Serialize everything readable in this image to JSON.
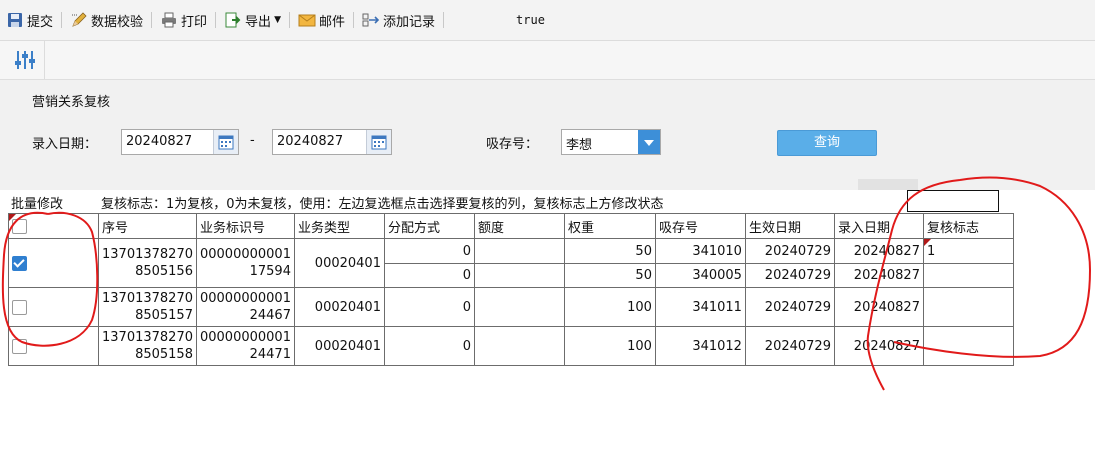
{
  "toolbar": {
    "items": [
      {
        "label": "提交",
        "icon": "save-icon"
      },
      {
        "label": "数据校验",
        "icon": "pencil-icon"
      },
      {
        "label": "打印",
        "icon": "printer-icon"
      },
      {
        "label": "导出",
        "icon": "export-icon"
      },
      {
        "label": "邮件",
        "icon": "mail-icon"
      },
      {
        "label": "添加记录",
        "icon": "add-record-icon"
      }
    ],
    "flag": "true"
  },
  "form": {
    "title": "营销关系复核",
    "date_label": "录入日期：",
    "date_from": "20240827",
    "date_sep": "-",
    "date_to": "20240827",
    "deposit_label": "吸存号：",
    "deposit_value": "李想",
    "query_label": "查询"
  },
  "info": {
    "batch_label": "批量修改",
    "hint": "复核标志：1为复核，0为未复核，使用：左边复选框点击选择要复核的列，复核标志上方修改状态"
  },
  "table": {
    "headers": [
      "",
      "序号",
      "业务标识号",
      "业务类型",
      "分配方式",
      "额度",
      "权重",
      "吸存号",
      "生效日期",
      "录入日期",
      "复核标志"
    ],
    "groups": [
      {
        "checked": true,
        "seq": [
          "13701378270",
          "8505156"
        ],
        "biz_id": [
          "00000000001",
          "17594"
        ],
        "biz_type": "00020401",
        "rows": [
          {
            "alloc": "0",
            "quota": "",
            "weight": "50",
            "deposit": "341010",
            "eff_date": "20240729",
            "entry_date": "20240827",
            "flag": "1"
          },
          {
            "alloc": "0",
            "quota": "",
            "weight": "50",
            "deposit": "340005",
            "eff_date": "20240729",
            "entry_date": "20240827",
            "flag": ""
          }
        ]
      },
      {
        "checked": false,
        "seq": [
          "13701378270",
          "8505157"
        ],
        "biz_id": [
          "00000000001",
          "24467"
        ],
        "biz_type": "00020401",
        "rows": [
          {
            "alloc": "0",
            "quota": "",
            "weight": "100",
            "deposit": "341011",
            "eff_date": "20240729",
            "entry_date": "20240827",
            "flag": ""
          }
        ]
      },
      {
        "checked": false,
        "seq": [
          "13701378270",
          "8505158"
        ],
        "biz_id": [
          "00000000001",
          "24471"
        ],
        "biz_type": "00020401",
        "rows": [
          {
            "alloc": "0",
            "quota": "",
            "weight": "100",
            "deposit": "341012",
            "eff_date": "20240729",
            "entry_date": "20240827",
            "flag": ""
          }
        ]
      }
    ]
  }
}
